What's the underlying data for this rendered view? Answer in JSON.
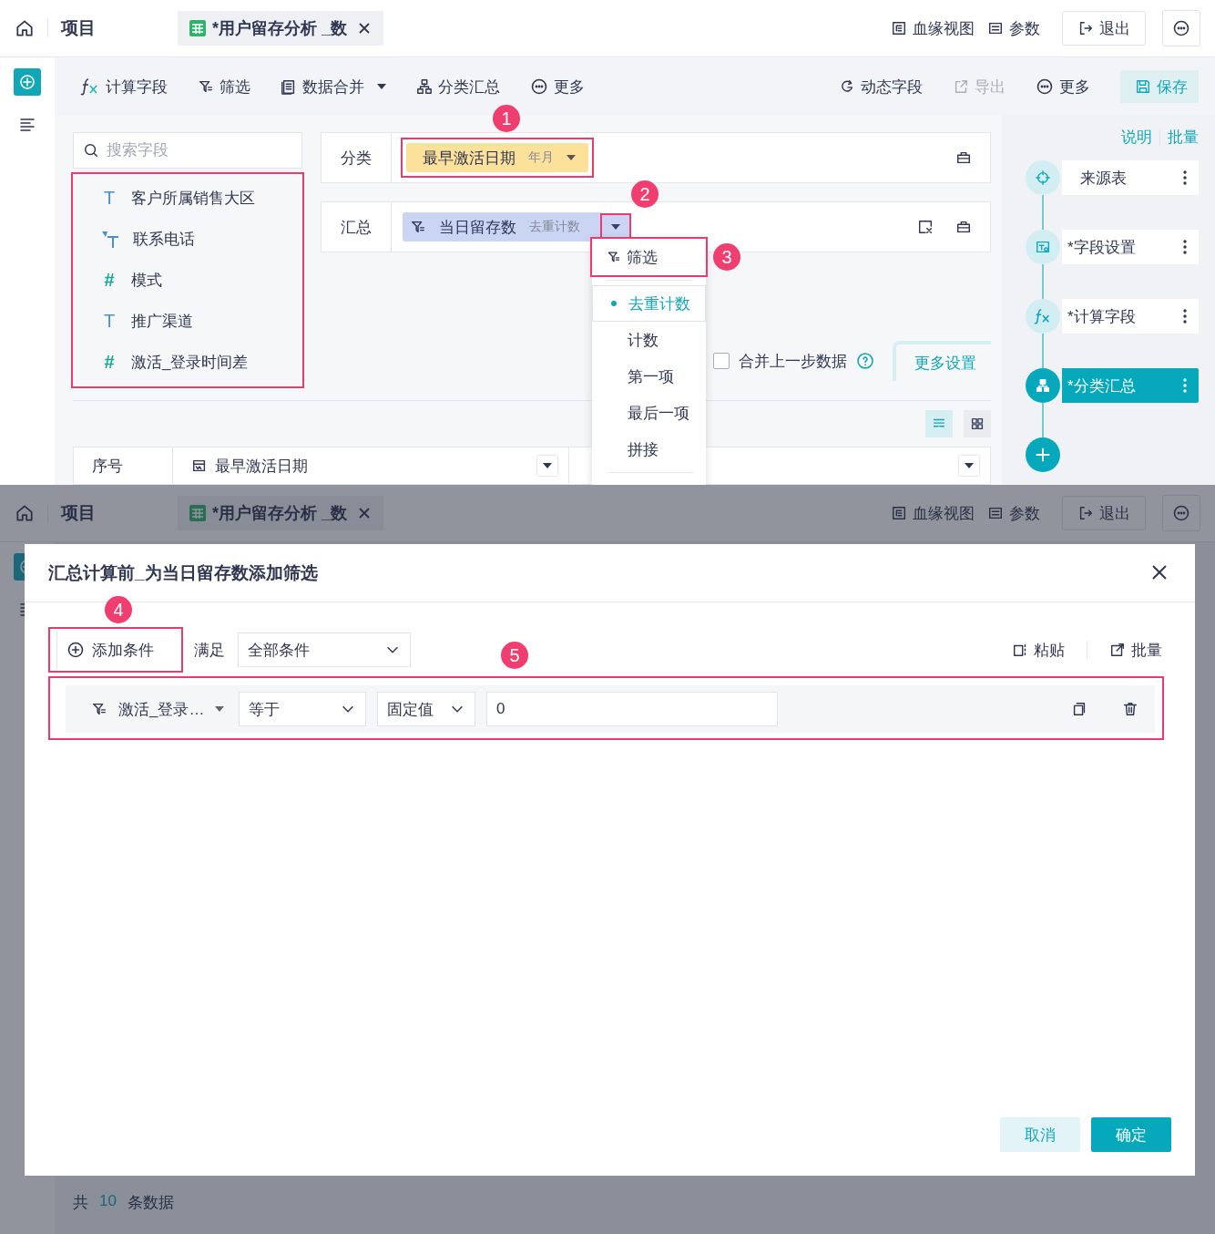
{
  "top": {
    "header": {
      "home": "项目",
      "tab": {
        "title": "*用户留存分析 _数"
      },
      "actions": [
        {
          "kind": "lineage",
          "label": "血缘视图"
        },
        {
          "kind": "params",
          "label": "参数"
        },
        {
          "kind": "exit",
          "label": "退出"
        }
      ]
    },
    "toolbar": {
      "left": [
        {
          "kind": "fx",
          "label": "计算字段",
          "dropdown": false
        },
        {
          "kind": "filter",
          "label": "筛选",
          "dropdown": false
        },
        {
          "kind": "merge",
          "label": "数据合并",
          "dropdown": true
        },
        {
          "kind": "group",
          "label": "分类汇总",
          "dropdown": false
        },
        {
          "kind": "more",
          "label": "更多",
          "dropdown": false
        }
      ],
      "right": [
        {
          "kind": "dynamic",
          "label": "动态字段",
          "disabled": false
        },
        {
          "kind": "export",
          "label": "导出",
          "disabled": true
        },
        {
          "kind": "more",
          "label": "更多",
          "disabled": false
        },
        {
          "kind": "save",
          "label": "保存",
          "disabled": false
        }
      ]
    },
    "search": {
      "placeholder": "搜索字段"
    },
    "fields": {
      "highlighted": true,
      "items": [
        {
          "kind": "text",
          "glyph": "T",
          "name": "客户所属销售大区"
        },
        {
          "kind": "phone",
          "name": "联系电话"
        },
        {
          "kind": "number",
          "glyph": "#",
          "name": "模式"
        },
        {
          "kind": "text",
          "glyph": "T",
          "name": "推广渠道"
        },
        {
          "kind": "number",
          "glyph": "#",
          "name": "激活_登录时间差"
        }
      ]
    },
    "category": {
      "label": "分类",
      "pill": {
        "name": "最早激活日期",
        "detail": "年月",
        "highlighted": true,
        "badge": "1"
      }
    },
    "summary": {
      "label": "汇总",
      "pill": {
        "name": "当日留存数",
        "detail": "去重计数"
      },
      "caret": {
        "highlighted": true,
        "badge": "2"
      }
    },
    "menu": {
      "items": [
        {
          "kind": "action",
          "label": "筛选",
          "highlighted": true,
          "badge": "3",
          "selected": false
        },
        {
          "kind": "option",
          "label": "去重计数",
          "highlighted": false,
          "selected": true
        },
        {
          "kind": "option",
          "label": "计数",
          "highlighted": false,
          "selected": false
        },
        {
          "kind": "option",
          "label": "第一项",
          "highlighted": false,
          "selected": false
        },
        {
          "kind": "option",
          "label": "最后一项",
          "highlighted": false,
          "selected": false
        },
        {
          "kind": "option",
          "label": "拼接",
          "highlighted": false,
          "selected": false
        }
      ]
    },
    "merge": {
      "label": "合并上一步数据",
      "checked": false
    },
    "more_settings": "更多设置",
    "table": {
      "columns": [
        {
          "label": "序号",
          "kind": "plain"
        },
        {
          "label": "最早激活日期",
          "kind": "date"
        }
      ]
    },
    "steps": {
      "links": [
        "说明",
        "批量"
      ],
      "items": [
        {
          "kind": "source",
          "label": "来源表",
          "selected": false
        },
        {
          "kind": "fields",
          "label": "*字段设置",
          "selected": false
        },
        {
          "kind": "fx",
          "label": "*计算字段",
          "selected": false
        },
        {
          "kind": "group",
          "label": "*分类汇总",
          "selected": true
        }
      ]
    }
  },
  "bottom": {
    "header": {
      "home": "项目",
      "tab": {
        "title": "*用户留存分析 _数"
      },
      "actions": [
        {
          "kind": "lineage",
          "label": "血缘视图"
        },
        {
          "kind": "params",
          "label": "参数"
        },
        {
          "kind": "exit",
          "label": "退出"
        }
      ]
    },
    "footer": {
      "prefix": "共",
      "count": "10",
      "suffix": "条数据"
    },
    "dialog": {
      "title": "汇总计算前_为当日留存数添加筛选",
      "add": {
        "label": "添加条件",
        "highlighted": true,
        "badge": "4"
      },
      "match_label": "满足",
      "match": {
        "value": "全部条件"
      },
      "tools": [
        {
          "kind": "paste",
          "label": "粘贴"
        },
        {
          "kind": "batch",
          "label": "批量"
        }
      ],
      "condition": {
        "highlighted": true,
        "badge": "5",
        "field": "激活_登录…",
        "operator": "等于",
        "value_type": "固定值",
        "value": "0"
      },
      "buttons": [
        {
          "kind": "secondary",
          "label": "取消"
        },
        {
          "kind": "primary",
          "label": "确定"
        }
      ]
    }
  }
}
